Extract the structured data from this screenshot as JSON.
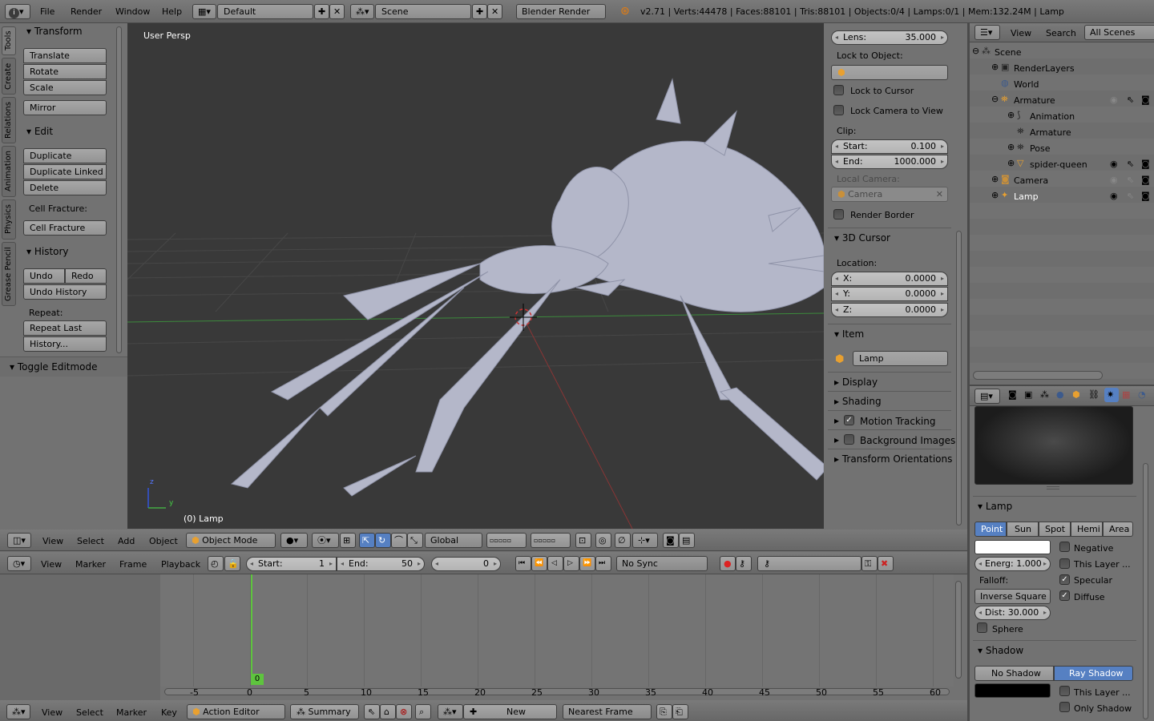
{
  "top_bar": {
    "info_icon": "info-icon",
    "menus": [
      "File",
      "Render",
      "Window",
      "Help"
    ],
    "screen_layout": "Default",
    "scene": "Scene",
    "render_engine": "Blender Render",
    "stats": "v2.71 | Verts:44478 | Faces:88101 | Tris:88101 | Objects:0/4 | Lamps:0/1 | Mem:132.24M | Lamp"
  },
  "tool_shelf": {
    "tabs": [
      "Tools",
      "Create",
      "Relations",
      "Animation",
      "Physics",
      "Grease Pencil"
    ],
    "transform_header": "Transform",
    "translate": "Translate",
    "rotate": "Rotate",
    "scale": "Scale",
    "mirror": "Mirror",
    "edit_header": "Edit",
    "duplicate": "Duplicate",
    "duplicate_linked": "Duplicate Linked",
    "delete": "Delete",
    "cell_fracture_label": "Cell Fracture:",
    "cell_fracture": "Cell Fracture",
    "history_header": "History",
    "undo": "Undo",
    "redo": "Redo",
    "undo_history": "Undo History",
    "repeat_label": "Repeat:",
    "repeat_last": "Repeat Last",
    "history_btn": "History...",
    "toggle_editmode": "Toggle Editmode"
  },
  "viewport": {
    "view_label": "User Persp",
    "object_label": "(0) Lamp",
    "axis_z": "z",
    "axis_y": "y"
  },
  "properties": {
    "lens_label": "Lens:",
    "lens_value": "35.000",
    "lock_to_object": "Lock to Object:",
    "lock_to_cursor": "Lock to Cursor",
    "lock_camera_to_view": "Lock Camera to View",
    "clip_label": "Clip:",
    "clip_start_label": "Start:",
    "clip_start_value": "0.100",
    "clip_end_label": "End:",
    "clip_end_value": "1000.000",
    "local_camera": "Local Camera:",
    "camera": "Camera",
    "render_border": "Render Border",
    "cursor_header": "3D Cursor",
    "location_label": "Location:",
    "x_label": "X:",
    "x_value": "0.0000",
    "y_label": "Y:",
    "y_value": "0.0000",
    "z_label": "Z:",
    "z_value": "0.0000",
    "item_header": "Item",
    "item_name": "Lamp",
    "display": "Display",
    "shading": "Shading",
    "motion_tracking": "Motion Tracking",
    "background_images": "Background Images",
    "transform_orientations": "Transform Orientations"
  },
  "viewport_header": {
    "menus": [
      "View",
      "Select",
      "Add",
      "Object"
    ],
    "mode": "Object Mode",
    "orientation": "Global"
  },
  "timeline_header": {
    "menus": [
      "View",
      "Marker",
      "Frame",
      "Playback"
    ],
    "start_label": "Start:",
    "start_value": "1",
    "end_label": "End:",
    "end_value": "50",
    "current_frame": "0",
    "sync": "No Sync"
  },
  "timeline": {
    "ticks": [
      "-5",
      "0",
      "5",
      "10",
      "15",
      "20",
      "25",
      "30",
      "35",
      "40",
      "45",
      "50",
      "55",
      "60"
    ],
    "cursor_frame": "0"
  },
  "dopesheet_header": {
    "menus": [
      "View",
      "Select",
      "Marker",
      "Key"
    ],
    "mode": "Action Editor",
    "summary": "Summary",
    "new_label": "New",
    "snap": "Nearest Frame"
  },
  "outliner": {
    "menus": [
      "View",
      "Search"
    ],
    "display_mode": "All Scenes",
    "items": [
      {
        "label": "Scene",
        "icon": "scene-icon"
      },
      {
        "label": "RenderLayers",
        "icon": "renderlayers-icon"
      },
      {
        "label": "World",
        "icon": "world-icon"
      },
      {
        "label": "Armature",
        "icon": "armature-icon"
      },
      {
        "label": "Animation",
        "icon": "animation-icon"
      },
      {
        "label": "Armature",
        "icon": "armature-data-icon"
      },
      {
        "label": "Pose",
        "icon": "pose-icon"
      },
      {
        "label": "spider-queen",
        "icon": "mesh-icon"
      },
      {
        "label": "Camera",
        "icon": "camera-icon"
      },
      {
        "label": "Lamp",
        "icon": "lamp-icon"
      }
    ]
  },
  "lamp_props": {
    "lamp_header": "Lamp",
    "types": [
      "Point",
      "Sun",
      "Spot",
      "Hemi",
      "Area"
    ],
    "active_type": "Point",
    "negative": "Negative",
    "this_layer": "This Layer ...",
    "energy": "Energ: 1.000",
    "falloff_label": "Falloff:",
    "specular": "Specular",
    "falloff": "Inverse Square",
    "diffuse": "Diffuse",
    "distance": "Dist: 30.000",
    "sphere": "Sphere",
    "shadow_header": "Shadow",
    "no_shadow": "No Shadow",
    "ray_shadow": "Ray Shadow",
    "shadow_this_layer": "This Layer ...",
    "only_shadow": "Only Shadow"
  },
  "colors": {
    "accent": "#5680c2",
    "viewport_bg": "#393939",
    "panel_bg": "#727272"
  }
}
